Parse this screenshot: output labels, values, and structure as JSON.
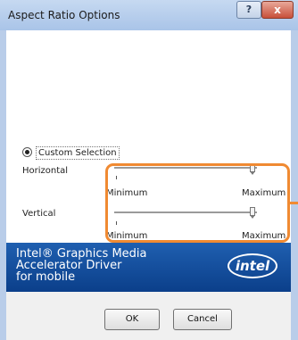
{
  "window": {
    "title": "Aspect Ratio Options",
    "help_label": "?",
    "close_label": "x"
  },
  "selection": {
    "radio_label": "Custom Selection"
  },
  "sliders": [
    {
      "label": "Horizontal",
      "min_label": "Minimum",
      "max_label": "Maximum",
      "value_fraction": 0.99
    },
    {
      "label": "Vertical",
      "min_label": "Minimum",
      "max_label": "Maximum",
      "value_fraction": 0.99
    }
  ],
  "banner": {
    "text": "Intel® Graphics Media\nAccelerator Driver\nfor mobile",
    "logo_text": "intel"
  },
  "buttons": {
    "ok": "OK",
    "cancel": "Cancel"
  },
  "colors": {
    "highlight": "#f08a32",
    "banner": "#1a56a6"
  }
}
